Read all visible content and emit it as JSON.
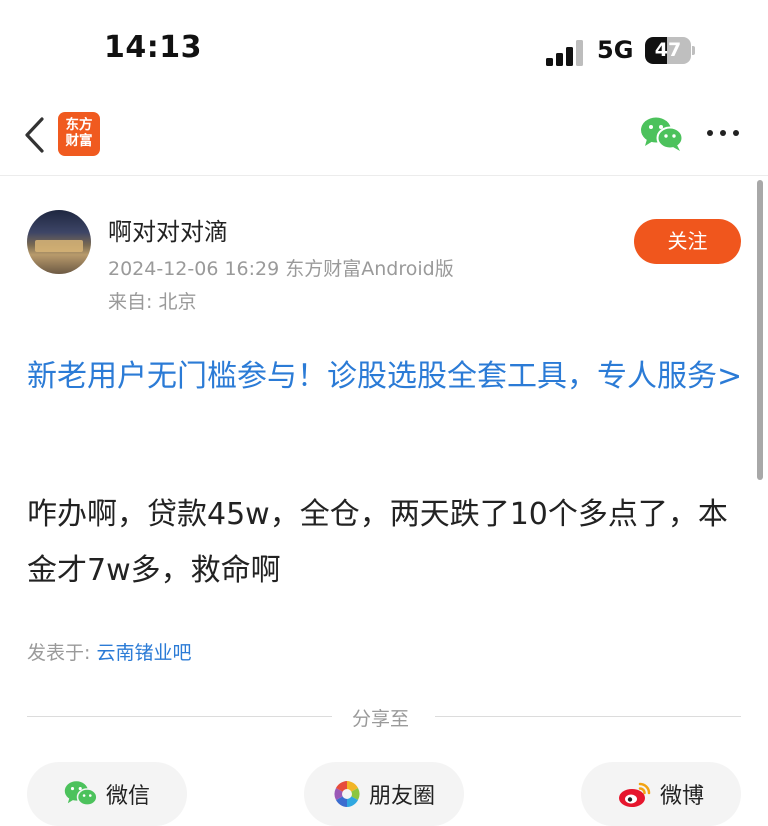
{
  "status_bar": {
    "time": "14:13",
    "network": "5G",
    "battery_level": "47",
    "battery_fraction": 0.47
  },
  "nav": {
    "logo_line1": "东方",
    "logo_line2": "财富",
    "brand_color": "#f05a1f",
    "icons": [
      "back-arrow-icon",
      "wechat-icon",
      "more-icon"
    ]
  },
  "post": {
    "author": "啊对对对滴",
    "meta": "2024-12-06 16:29 东方财富Android版",
    "location": "来自: 北京",
    "follow_label": "关注",
    "promo_text": "新老用户无门槛参与！诊股选股全套工具，专人服务>",
    "content": "咋办啊，贷款45w，全仓，两天跌了10个多点了，本金才7w多，救命啊",
    "posted_prefix": "发表于: ",
    "posted_bar": "云南锗业吧",
    "link_color": "#2b7bd6",
    "accent_color": "#f0561d"
  },
  "share": {
    "label": "分享至",
    "wechat": "微信",
    "moments": "朋友圈",
    "weibo": "微博"
  }
}
